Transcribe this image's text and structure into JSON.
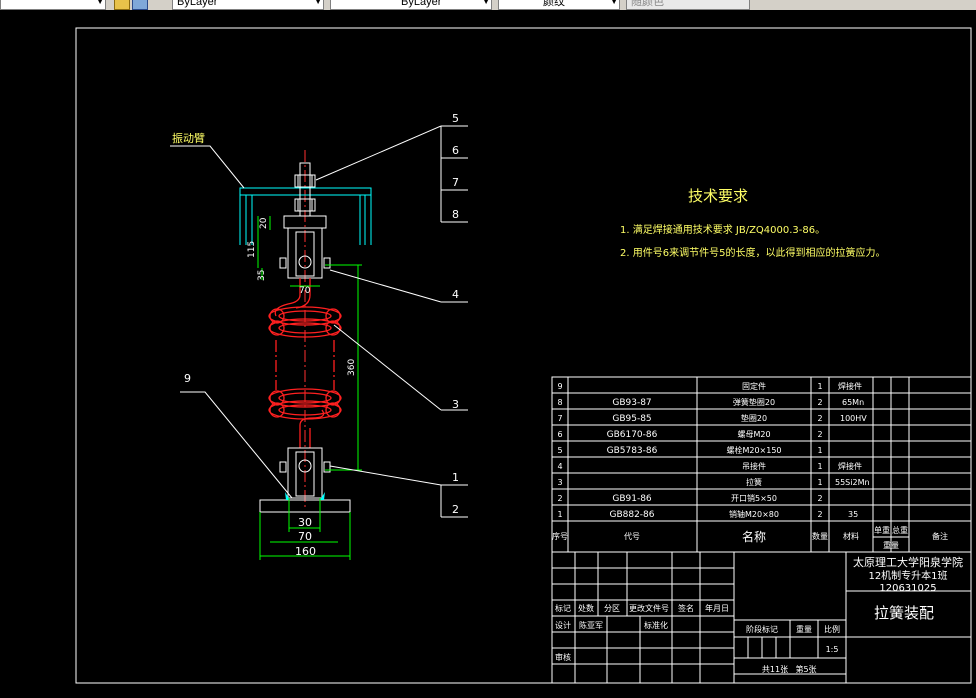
{
  "toolbar": {
    "layer1": "ByLayer",
    "layer2": "ByLayer",
    "linetype": "颜纹",
    "color": "随颜色"
  },
  "drawing": {
    "tech_title": "技术要求",
    "tech_items": [
      "1. 满足焊接通用技术要求 JB/ZQ4000.3-86。",
      "2. 用件号6来调节件号5的长度，以此得到相应的拉簧应力。"
    ],
    "callouts": [
      "5",
      "6",
      "7",
      "8",
      "4",
      "3",
      "1",
      "2",
      "9"
    ],
    "leader_label": "振动臂",
    "dims": {
      "d20": "20",
      "d115": "115",
      "d35": "35",
      "d70a": "70",
      "d360": "360",
      "d30": "30",
      "d70b": "70",
      "d160": "160"
    }
  },
  "bom": {
    "rows": [
      {
        "no": "9",
        "code": "",
        "name": "固定件",
        "qty": "1",
        "mat": "焊接件"
      },
      {
        "no": "8",
        "code": "GB93-87",
        "name": "弹簧垫圈20",
        "qty": "2",
        "mat": "65Mn"
      },
      {
        "no": "7",
        "code": "GB95-85",
        "name": "垫圈20",
        "qty": "2",
        "mat": "100HV"
      },
      {
        "no": "6",
        "code": "GB6170-86",
        "name": "螺母M20",
        "qty": "2",
        "mat": ""
      },
      {
        "no": "5",
        "code": "GB5783-86",
        "name": "螺栓M20×150",
        "qty": "1",
        "mat": ""
      },
      {
        "no": "4",
        "code": "",
        "name": "吊接件",
        "qty": "1",
        "mat": "焊接件"
      },
      {
        "no": "3",
        "code": "",
        "name": "拉簧",
        "qty": "1",
        "mat": "55Si2Mn"
      },
      {
        "no": "2",
        "code": "GB91-86",
        "name": "开口销5×50",
        "qty": "2",
        "mat": ""
      },
      {
        "no": "1",
        "code": "GB882-86",
        "name": "销轴M20×80",
        "qty": "2",
        "mat": "35"
      }
    ],
    "header": {
      "no": "序号",
      "code": "代号",
      "name": "名称",
      "qty": "数量",
      "mat": "材料",
      "single": "单重",
      "total": "总重",
      "note": "备注",
      "weight": "重量"
    }
  },
  "titleblock": {
    "school1": "太原理工大学阳泉学院",
    "school2": "12机制专升本1班",
    "student_id": "120631025",
    "drawing_title": "拉簧装配",
    "marks": [
      "标记",
      "处数",
      "分区",
      "更改文件号",
      "签名",
      "年月日"
    ],
    "design": "设计",
    "designer": "陈亚军",
    "standard": "标准化",
    "stage": "阶段标记",
    "weight": "重量",
    "scale": "比例",
    "scale_value": "1:5",
    "review": "审核",
    "sheets": "共11张",
    "sheet_no": "第5张"
  }
}
